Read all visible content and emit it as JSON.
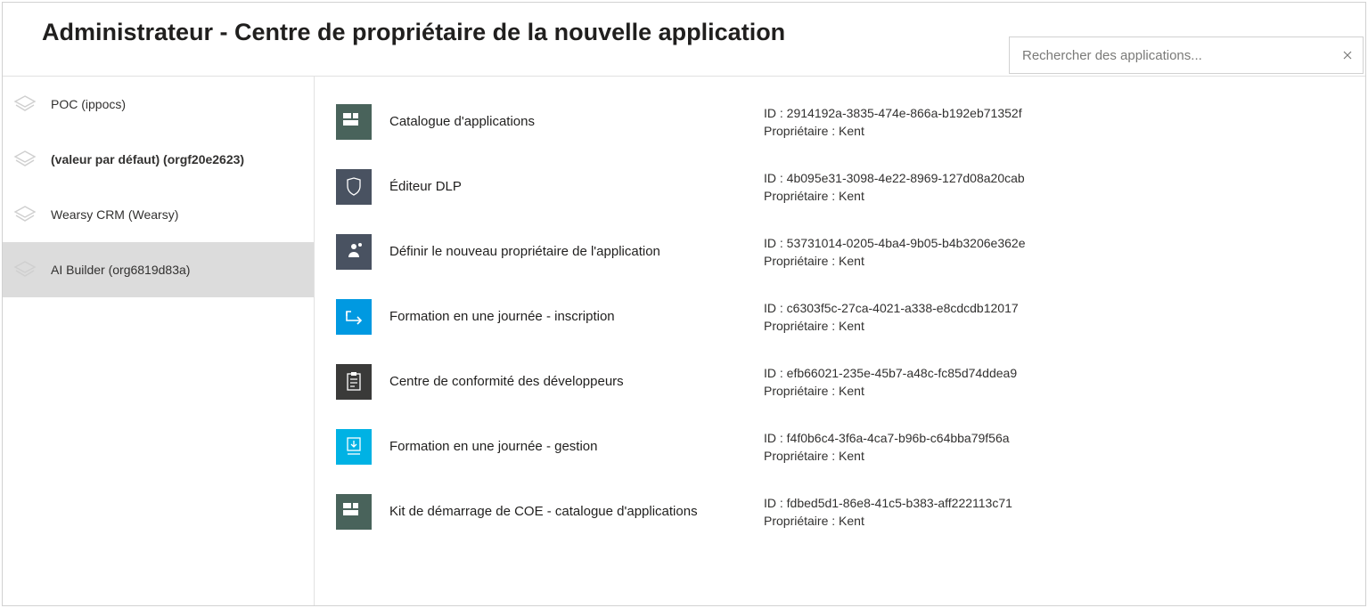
{
  "header": {
    "title": "Administrateur - Centre de propriétaire de la nouvelle application"
  },
  "search": {
    "placeholder": "Rechercher des applications...",
    "value": ""
  },
  "sidebar": {
    "items": [
      {
        "label": "POC (ippocs)",
        "bold": false,
        "selected": false
      },
      {
        "label": "(valeur par défaut) (orgf20e2623)",
        "bold": true,
        "selected": false
      },
      {
        "label": "Wearsy CRM (Wearsy)",
        "bold": false,
        "selected": false
      },
      {
        "label": "AI Builder (org6819d83a)",
        "bold": false,
        "selected": true
      }
    ]
  },
  "labels": {
    "id_prefix": "ID : ",
    "owner_prefix": "Propriétaire : "
  },
  "apps": [
    {
      "icon": "tiles",
      "tile": "tile-green-dark",
      "name": "Catalogue d'applications",
      "id": "2914192a-3835-474e-866a-b192eb71352f",
      "owner": "Kent"
    },
    {
      "icon": "shield",
      "tile": "tile-slate",
      "name": "Éditeur DLP",
      "id": "4b095e31-3098-4e22-8969-127d08a20cab",
      "owner": "Kent"
    },
    {
      "icon": "owner",
      "tile": "tile-slate",
      "name": "Définir le nouveau propriétaire de l'application",
      "id": "53731014-0205-4ba4-9b05-b4b3206e362e",
      "owner": "Kent"
    },
    {
      "icon": "arrow",
      "tile": "tile-blue-light",
      "name": "Formation en une journée - inscription",
      "id": "c6303f5c-27ca-4021-a338-e8cdcdb12017",
      "owner": "Kent"
    },
    {
      "icon": "clipboard",
      "tile": "tile-gray-dark",
      "name": "Centre de conformité des développeurs",
      "id": "efb66021-235e-45b7-a48c-fc85d74ddea9",
      "owner": "Kent"
    },
    {
      "icon": "download",
      "tile": "tile-cyan",
      "name": "Formation en une journée - gestion",
      "id": "f4f0b6c4-3f6a-4ca7-b96b-c64bba79f56a",
      "owner": "Kent"
    },
    {
      "icon": "tiles",
      "tile": "tile-green-dark",
      "name": "Kit de démarrage de COE - catalogue d'applications",
      "id": "fdbed5d1-86e8-41c5-b383-aff222113c71",
      "owner": "Kent"
    }
  ]
}
